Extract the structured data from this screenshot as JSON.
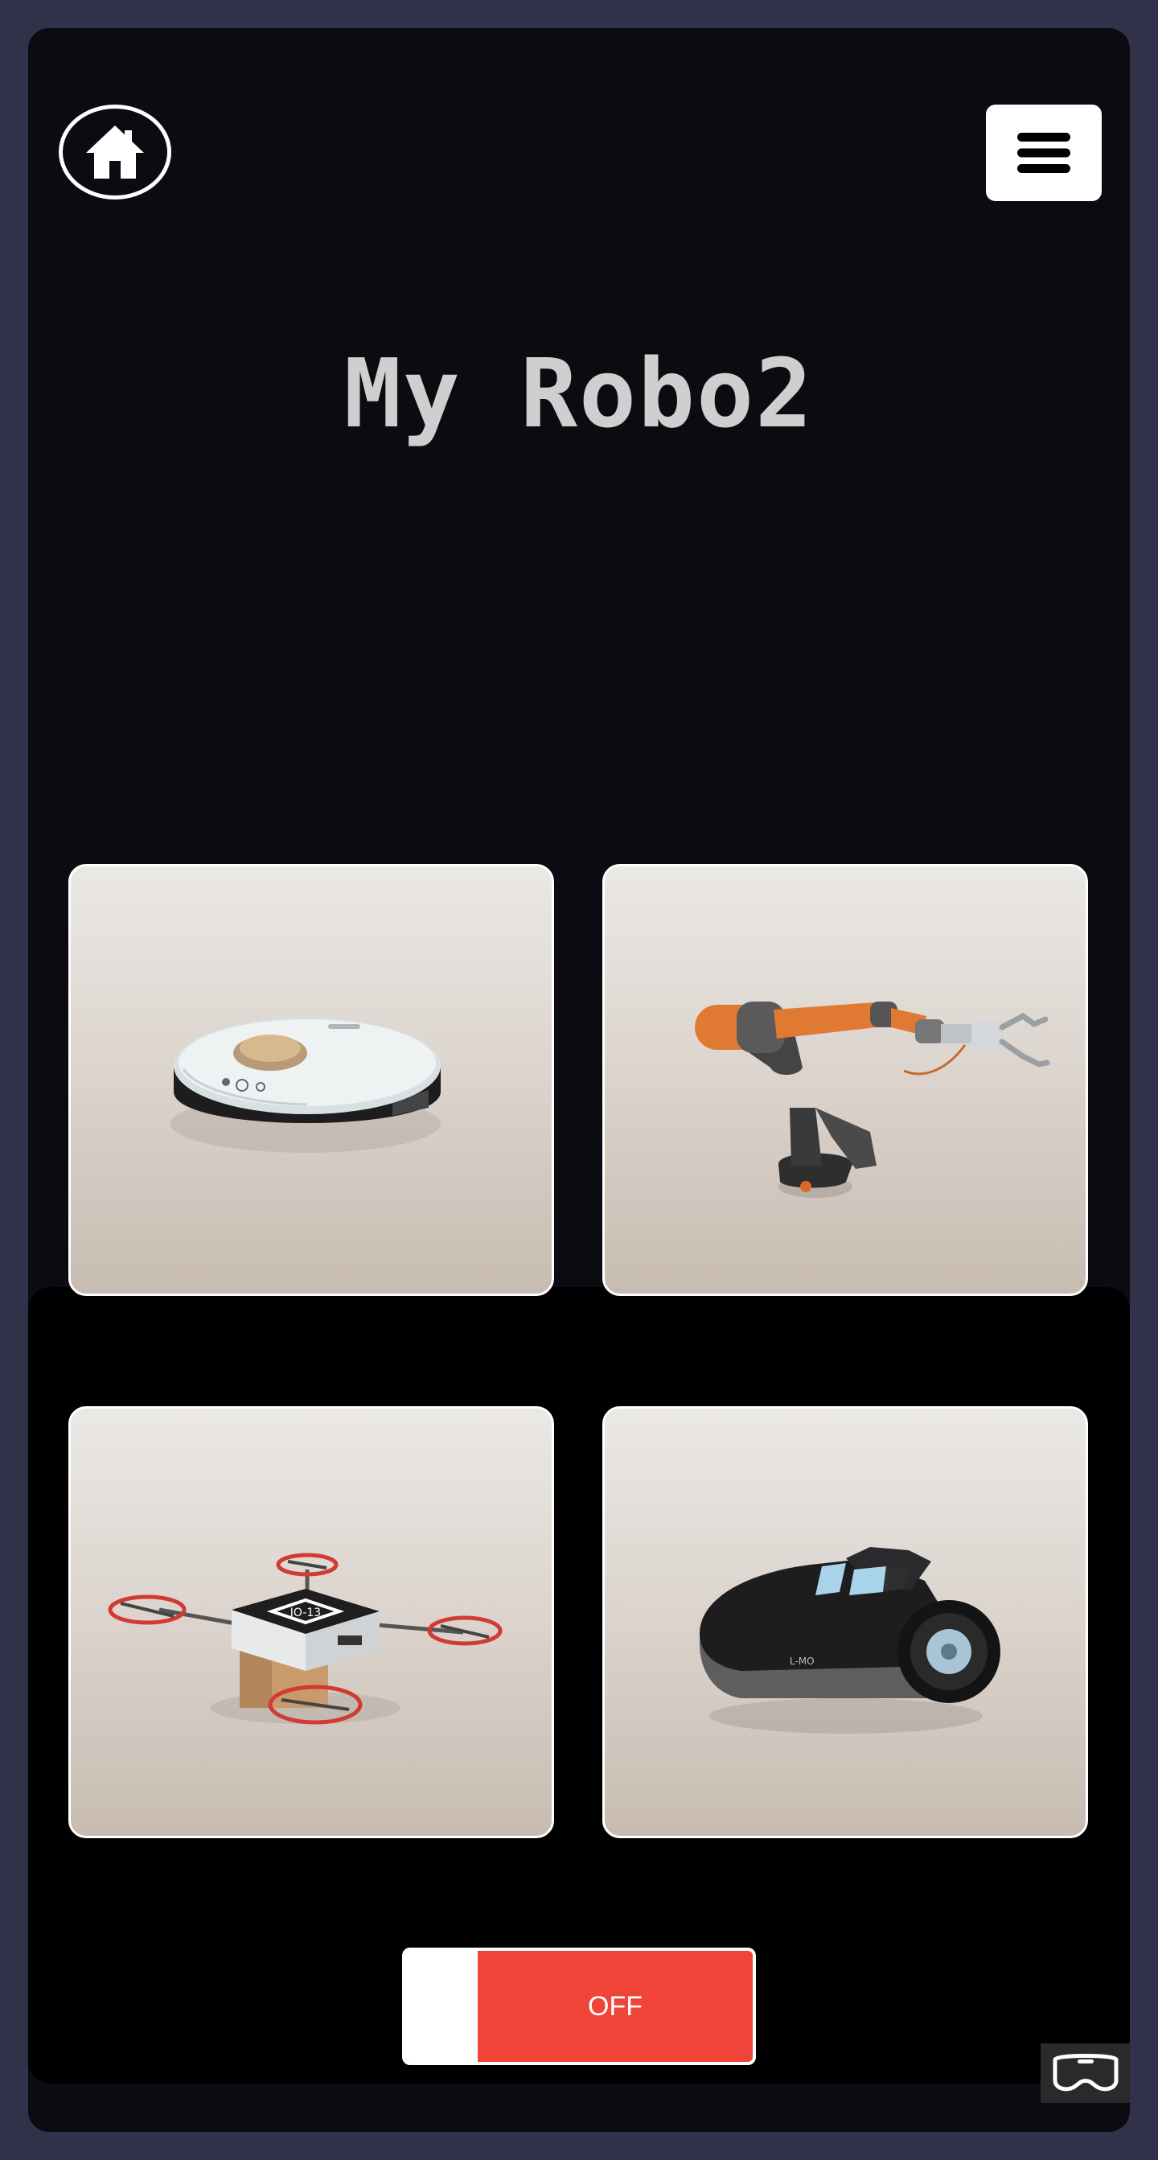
{
  "title": "My Robo2",
  "header": {
    "home_icon": "home-icon",
    "menu_icon": "hamburger-menu-icon"
  },
  "robots": [
    {
      "icon": "robot-vacuum-image"
    },
    {
      "icon": "robotic-arm-image"
    },
    {
      "icon": "delivery-drone-image"
    },
    {
      "icon": "robot-lawn-mower-image"
    }
  ],
  "power_toggle": {
    "label": "OFF",
    "state": "off",
    "color": "#f04438"
  },
  "vr_button": {
    "icon": "vr-headset-icon"
  },
  "colors": {
    "page_background": "#32314a",
    "frame_background": "#0c0b11",
    "title_text": "#cfcfcf"
  }
}
